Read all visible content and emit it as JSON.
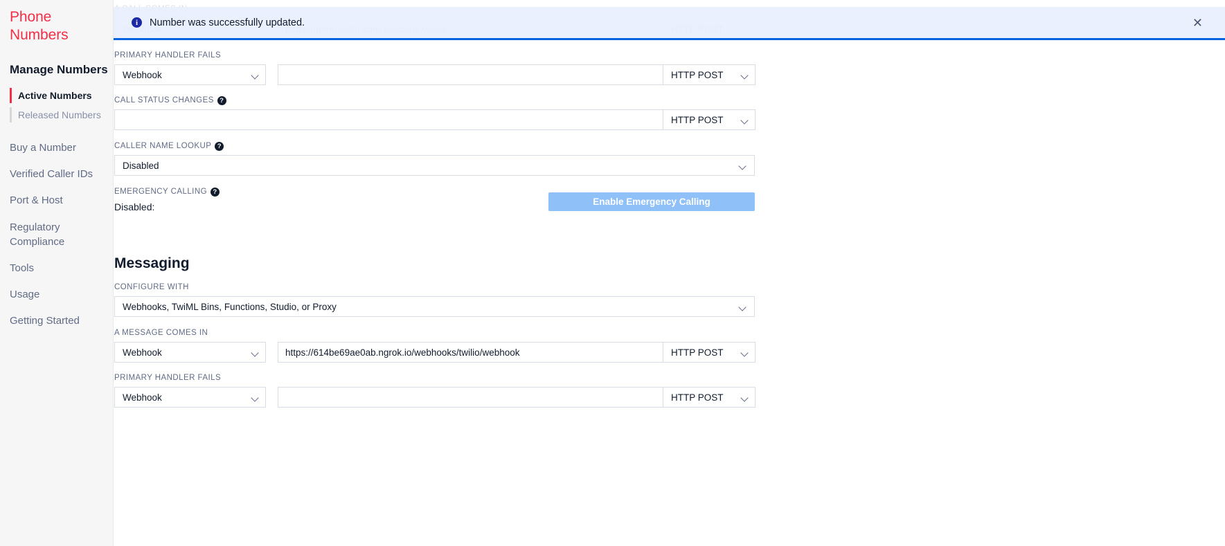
{
  "sidebar": {
    "brand": "Phone Numbers",
    "section_title": "Manage Numbers",
    "sub_items": [
      {
        "label": "Active Numbers",
        "active": true
      },
      {
        "label": "Released Numbers",
        "active": false
      }
    ],
    "links": [
      {
        "label": "Buy a Number"
      },
      {
        "label": "Verified Caller IDs"
      },
      {
        "label": "Port & Host"
      },
      {
        "label": "Regulatory Compliance"
      },
      {
        "label": "Tools"
      },
      {
        "label": "Usage"
      },
      {
        "label": "Getting Started"
      }
    ]
  },
  "banner": {
    "message": "Number was successfully updated.",
    "info_icon": "info-icon",
    "close_icon": "close-icon",
    "close_label": "✕",
    "info_glyph": "i",
    "accent_color": "#0263e0",
    "background_color": "#e8effd"
  },
  "obscured_row": {
    "label": "A CALL COMES IN",
    "handler": "Webhook",
    "url": "https://demo.twilio.com/welcome/voice/",
    "method": "HTTP POST"
  },
  "voice": {
    "primary_handler_fails": {
      "label": "PRIMARY HANDLER FAILS",
      "handler": "Webhook",
      "url": "",
      "url_placeholder": "",
      "method": "HTTP POST"
    },
    "call_status_changes": {
      "label": "CALL STATUS CHANGES",
      "has_help": true,
      "help_glyph": "?",
      "url": "",
      "url_placeholder": "",
      "method": "HTTP POST"
    },
    "caller_name_lookup": {
      "label": "CALLER NAME LOOKUP",
      "has_help": true,
      "help_glyph": "?",
      "value": "Disabled"
    },
    "emergency_calling": {
      "label": "EMERGENCY CALLING",
      "has_help": true,
      "help_glyph": "?",
      "status": "Disabled:",
      "button_label": "Enable Emergency Calling",
      "button_color": "#8fc0f7"
    }
  },
  "messaging": {
    "heading": "Messaging",
    "configure_with": {
      "label": "CONFIGURE WITH",
      "value": "Webhooks, TwiML Bins, Functions, Studio, or Proxy"
    },
    "a_message_comes_in": {
      "label": "A MESSAGE COMES IN",
      "handler": "Webhook",
      "url": "https://614be69ae0ab.ngrok.io/webhooks/twilio/webhook",
      "method": "HTTP POST"
    },
    "primary_handler_fails": {
      "label": "PRIMARY HANDLER FAILS",
      "handler": "Webhook",
      "url": "",
      "url_placeholder": "",
      "method": "HTTP POST"
    }
  }
}
